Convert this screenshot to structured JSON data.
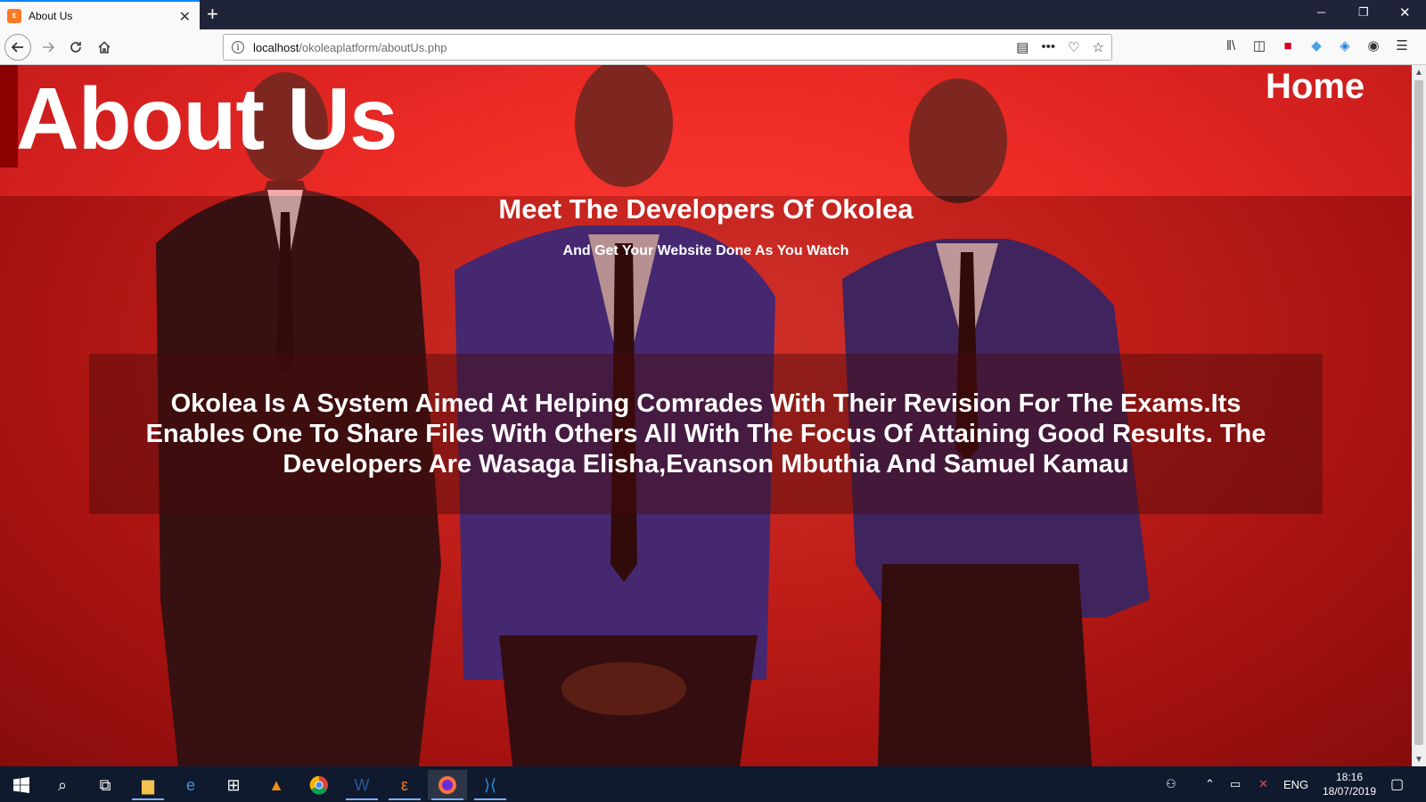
{
  "browser": {
    "tab_title": "About Us",
    "favicon_glyph": "ε",
    "url_host": "localhost",
    "url_path": "/okoleaplatform/aboutUs.php"
  },
  "page": {
    "heading": "About Us",
    "home_link": "Home",
    "subheading": "Meet The Developers Of Okolea",
    "tagline": "And Get Your Website Done As You Watch",
    "description": "Okolea Is A System Aimed At Helping Comrades With Their Revision For The Exams.Its Enables One To Share Files With Others All With The Focus Of Attaining Good Results. The Developers Are Wasaga Elisha,Evanson Mbuthia And Samuel Kamau"
  },
  "taskbar": {
    "language": "ENG",
    "time": "18:16",
    "date": "18/07/2019"
  },
  "colors": {
    "accent_red": "#e82a22",
    "dark_red": "#8b0000",
    "taskbar": "#0f1a2e"
  }
}
